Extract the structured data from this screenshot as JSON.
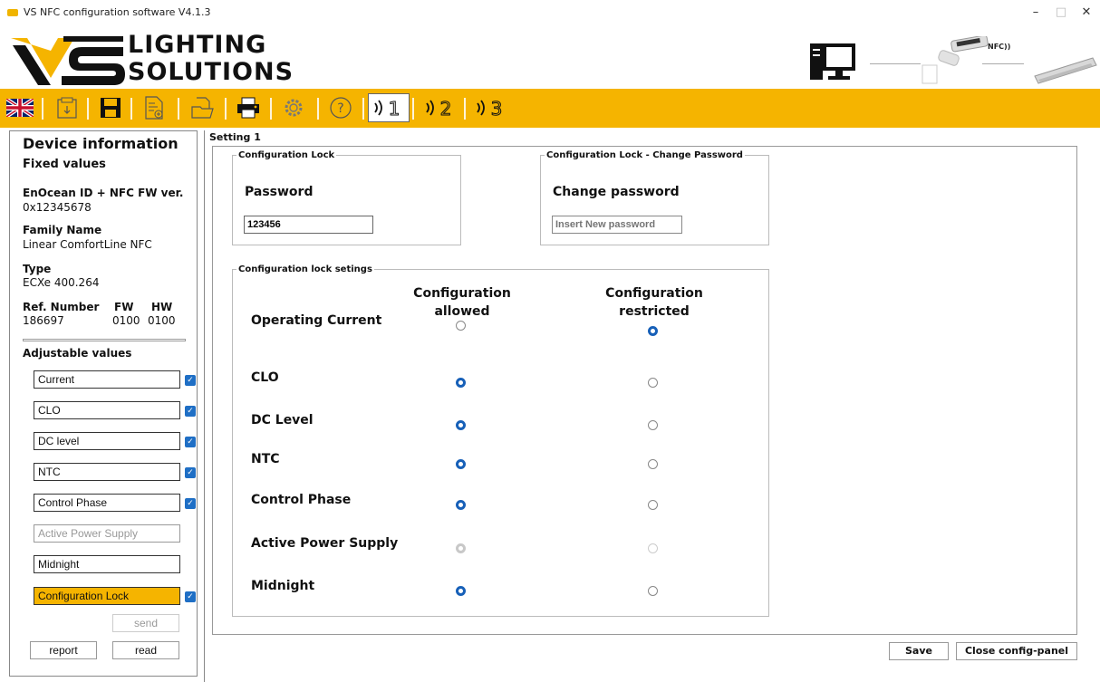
{
  "window": {
    "title": "VS NFC configuration software V4.1.3",
    "min": "–",
    "max": "□",
    "close": "✕"
  },
  "brand": {
    "line1": "LIGHTING",
    "line2": "SOLUTIONS",
    "logo_text": "VS",
    "nfc_badge": "NFC))"
  },
  "toolbar": {
    "items": [
      {
        "icon": "uk-flag-icon"
      },
      {
        "icon": "download-icon"
      },
      {
        "icon": "save-icon"
      },
      {
        "icon": "document-add-icon"
      },
      {
        "icon": "folder-open-icon"
      },
      {
        "icon": "printer-icon"
      },
      {
        "icon": "gear-icon"
      },
      {
        "icon": "help-icon"
      },
      {
        "icon": "nfc-setting-1-icon"
      },
      {
        "icon": "nfc-setting-2-icon"
      },
      {
        "icon": "nfc-setting-3-icon"
      }
    ],
    "help_glyph": "?",
    "setting1": "1",
    "setting2": "2",
    "setting3": "3",
    "accent": "#f5b400"
  },
  "device": {
    "heading": "Device information",
    "fixed_heading": "Fixed values",
    "enocean_label": "EnOcean ID + NFC FW ver.",
    "enocean_value": "0x12345678",
    "family_label": "Family Name",
    "family_value": "Linear ComfortLine NFC",
    "type_label": "Type",
    "type_value": "ECXe 400.264",
    "ref_label": "Ref. Number",
    "ref_value": "186697",
    "fw_label": "FW",
    "fw_value": "0100",
    "hw_label": "HW",
    "hw_value": "0100",
    "adjustable_heading": "Adjustable values",
    "adjustable": [
      {
        "label": "Current",
        "checked": true
      },
      {
        "label": "CLO",
        "checked": true
      },
      {
        "label": "DC level",
        "checked": true
      },
      {
        "label": "NTC",
        "checked": true
      },
      {
        "label": "Control Phase",
        "checked": true
      },
      {
        "label": "Active Power Supply",
        "checked": false
      },
      {
        "label": "Midnight",
        "checked": false
      },
      {
        "label": "Configuration Lock",
        "checked": true
      }
    ],
    "check_glyph": "✓",
    "send": "send",
    "report": "report",
    "read": "read"
  },
  "main": {
    "setting_title": "Setting 1",
    "lock_group": "Configuration Lock",
    "password_label": "Password",
    "password_value": "123456",
    "change_group": "Configuration Lock - Change Password",
    "change_label": "Change password",
    "change_placeholder": "Insert New password",
    "settings_group": "Configuration lock setings",
    "col_allowed": "Configuration allowed",
    "col_restricted": "Configuration restricted",
    "rows": [
      {
        "label": "Operating Current",
        "allowed": false,
        "restricted": true,
        "disabled": false
      },
      {
        "label": "CLO",
        "allowed": true,
        "restricted": false,
        "disabled": false
      },
      {
        "label": "DC Level",
        "allowed": true,
        "restricted": false,
        "disabled": false
      },
      {
        "label": "NTC",
        "allowed": true,
        "restricted": false,
        "disabled": false
      },
      {
        "label": "Control Phase",
        "allowed": true,
        "restricted": false,
        "disabled": false
      },
      {
        "label": "Active Power Supply",
        "allowed": true,
        "restricted": false,
        "disabled": true
      },
      {
        "label": "Midnight",
        "allowed": true,
        "restricted": false,
        "disabled": false
      }
    ],
    "save": "Save",
    "close": "Close config-panel"
  }
}
